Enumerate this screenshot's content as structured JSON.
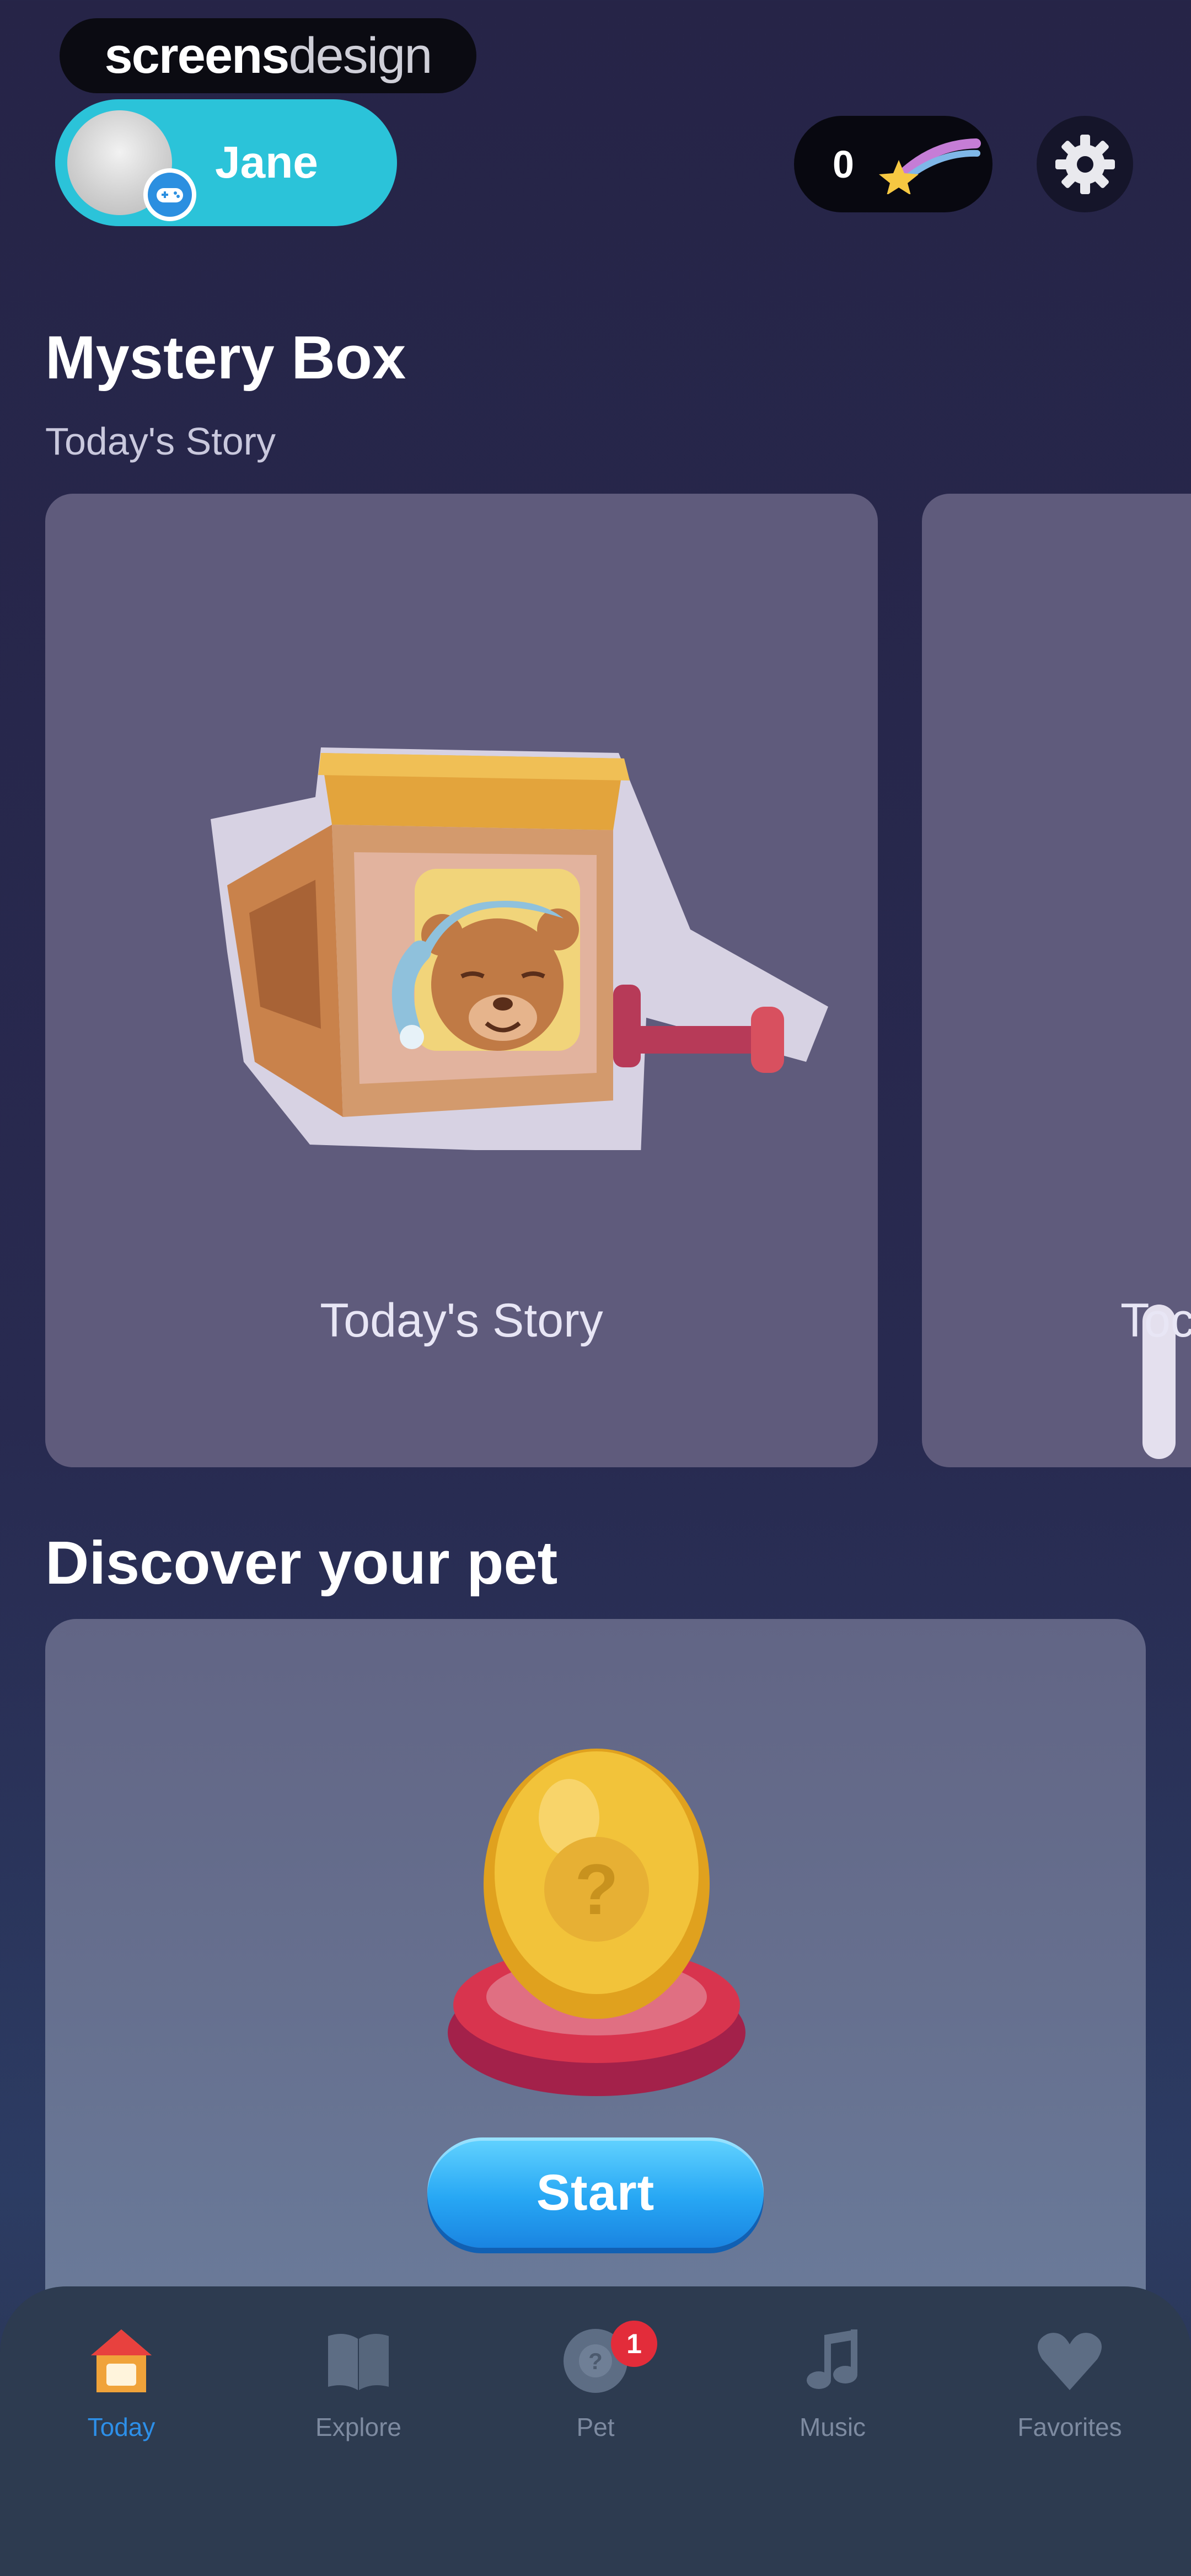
{
  "watermark": {
    "part1": "screens",
    "part2": "design"
  },
  "header": {
    "profile_name": "Jane",
    "coins": "0"
  },
  "mystery_box": {
    "title": "Mystery Box",
    "subtitle": "Today's Story",
    "cards": [
      {
        "label": "Today's Story"
      },
      {
        "label": "Toc"
      }
    ]
  },
  "pet": {
    "title": "Discover your pet",
    "egg_mark": "?",
    "start_label": "Start"
  },
  "tabs": [
    {
      "label": "Today",
      "icon": "home-icon",
      "active": true
    },
    {
      "label": "Explore",
      "icon": "book-icon",
      "active": false
    },
    {
      "label": "Pet",
      "icon": "pet-icon",
      "active": false,
      "badge": "1"
    },
    {
      "label": "Music",
      "icon": "music-note-icon",
      "active": false
    },
    {
      "label": "Favorites",
      "icon": "heart-icon",
      "active": false
    }
  ],
  "colors": {
    "background": "#262447",
    "profile_pill": "#2bc3d9",
    "card": "#5f5b7c",
    "start_button": "#27a7f4",
    "active_tab": "#2d8fe8",
    "badge": "#e32c3a"
  }
}
